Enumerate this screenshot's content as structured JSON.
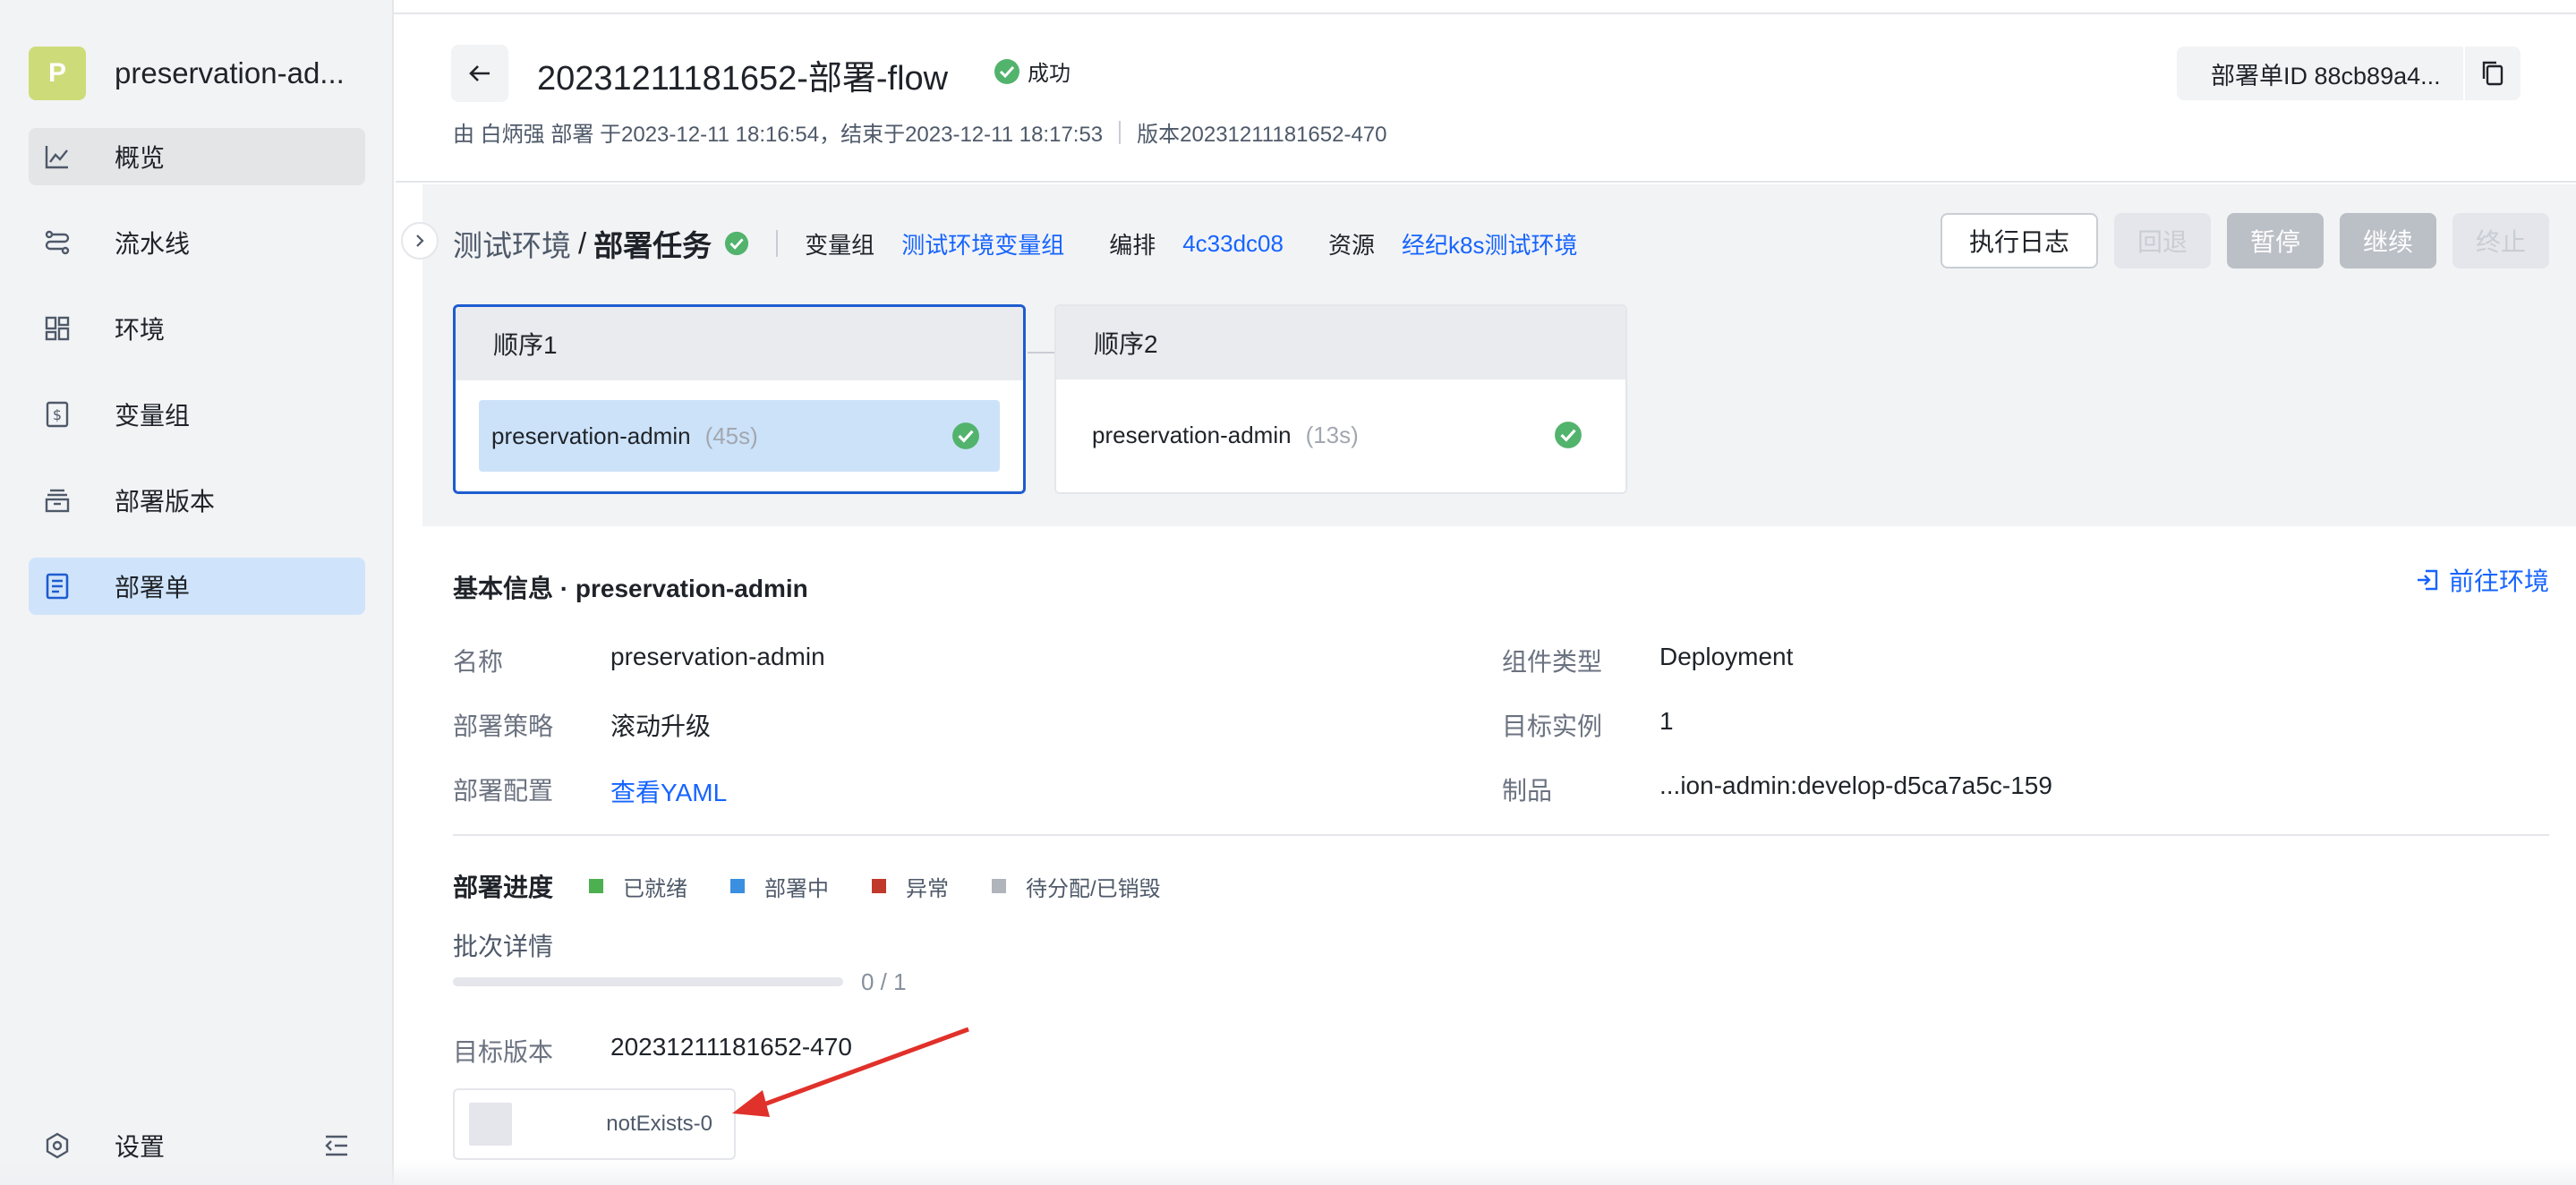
{
  "sidebar": {
    "avatar_letter": "P",
    "app_name": "preservation-ad...",
    "items": [
      {
        "label": "概览",
        "icon": "chart-line-icon"
      },
      {
        "label": "流水线",
        "icon": "pipeline-icon"
      },
      {
        "label": "环境",
        "icon": "grid-icon"
      },
      {
        "label": "变量组",
        "icon": "dollar-file-icon"
      },
      {
        "label": "部署版本",
        "icon": "archive-icon"
      },
      {
        "label": "部署单",
        "icon": "document-icon"
      }
    ],
    "settings_label": "设置"
  },
  "header": {
    "title": "20231211181652-部署-flow",
    "status": "成功",
    "meta_by": "由 白炳强 部署  于2023-12-11 18:16:54，结束于2023-12-11 18:17:53",
    "meta_version": "版本20231211181652-470",
    "deploy_id": "部署单ID 88cb89a4..."
  },
  "stage": {
    "env_label": "测试环境",
    "slash": "/",
    "task_label": "部署任务",
    "vargroup_key": "变量组",
    "vargroup_val": "测试环境变量组",
    "compose_key": "编排",
    "compose_val": "4c33dc08",
    "resource_key": "资源",
    "resource_val": "经纪k8s测试环境",
    "buttons": {
      "log": "执行日志",
      "rollback": "回退",
      "pause": "暂停",
      "resume": "继续",
      "stop": "终止"
    },
    "sequences": [
      {
        "title": "顺序1",
        "job": "preservation-admin",
        "duration": "(45s)"
      },
      {
        "title": "顺序2",
        "job": "preservation-admin",
        "duration": "(13s)"
      }
    ]
  },
  "detail": {
    "section_title": "基本信息 · preservation-admin",
    "goto_env": "前往环境",
    "fields": {
      "name_label": "名称",
      "name_val": "preservation-admin",
      "strategy_label": "部署策略",
      "strategy_val": "滚动升级",
      "config_label": "部署配置",
      "config_val": "查看YAML",
      "type_label": "组件类型",
      "type_val": "Deployment",
      "replicas_label": "目标实例",
      "replicas_val": "1",
      "artifact_label": "制品",
      "artifact_val": "...ion-admin:develop-d5ca7a5c-159"
    },
    "progress": {
      "title": "部署进度",
      "legend": [
        {
          "label": "已就绪",
          "color": "#4caf50"
        },
        {
          "label": "部署中",
          "color": "#3b8fe0"
        },
        {
          "label": "异常",
          "color": "#c0392b"
        },
        {
          "label": "待分配/已销毁",
          "color": "#b0b4bb"
        }
      ],
      "batch_label": "批次详情",
      "ready": 0,
      "total": 1,
      "count_text": "0 / 1",
      "target_version_label": "目标版本",
      "target_version_val": "20231211181652-470",
      "pod_name": "notExists-0"
    }
  },
  "colors": {
    "accent": "#1664ff",
    "success": "#52b36d",
    "selected_border": "#1e5ccf",
    "sidebar_active": "#cfe4fb",
    "annotation_arrow": "#e0312a"
  }
}
